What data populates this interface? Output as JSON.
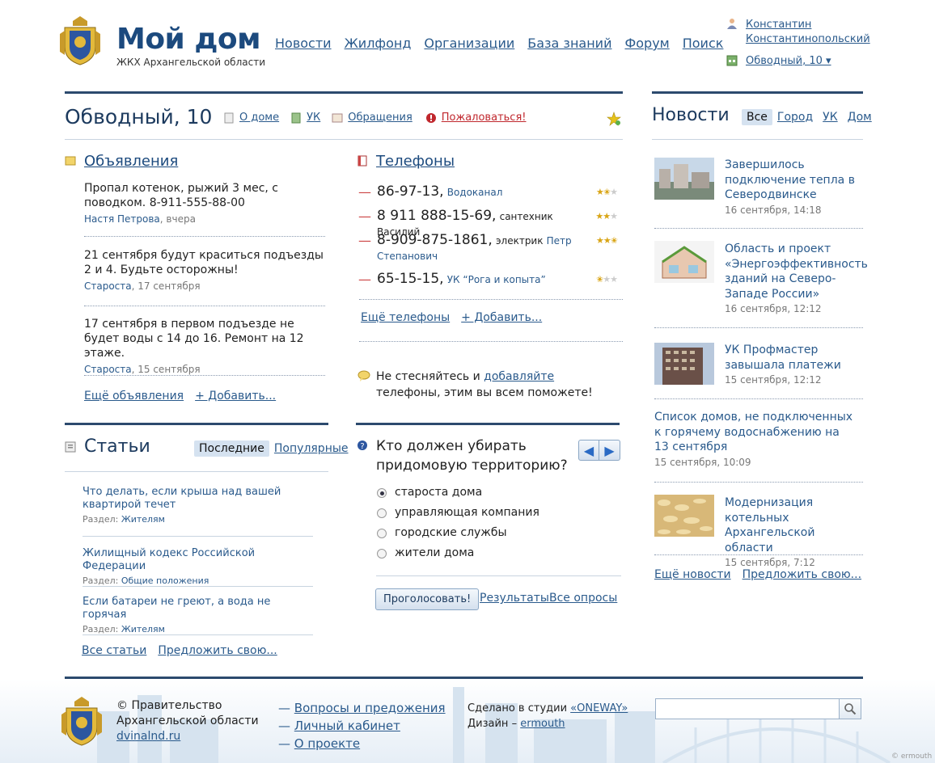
{
  "header": {
    "logo_title": "Мой дом",
    "logo_subtitle": "ЖКХ Архангельской области",
    "nav": [
      "Новости",
      "Жилфонд",
      "Организации",
      "База знаний",
      "Форум",
      "Поиск"
    ],
    "user_first": "Константин",
    "user_last": "Константинопольский",
    "address": "Обводный, 10 ▾"
  },
  "house": {
    "title": "Обводный, 10",
    "tabs": [
      "О доме",
      "УК",
      "Обращения"
    ],
    "complain": "Пожаловаться!"
  },
  "ads": {
    "title": "Объявления",
    "items": [
      {
        "text": "Пропал котенок, рыжий 3 мес, с поводком. 8-911-555-88-00",
        "author": "Настя Петрова",
        "date": ", вчера"
      },
      {
        "text": "21 сентября будут краситься подъезды 2 и 4. Будьте осторожны!",
        "author": "Староста",
        "date": ", 17 сентября"
      },
      {
        "text": "17 сентября в первом подъезде не будет воды с 14 до 16. Ремонт на 12 этаже.",
        "author": "Староста",
        "date": ", 15 сентября"
      }
    ],
    "more": "Ещё объявления",
    "add": "+ Добавить..."
  },
  "phones": {
    "title": "Телефоны",
    "items": [
      {
        "number": "86-97-13,",
        "desc": "",
        "link": "Водоканал",
        "rating": 1.5
      },
      {
        "number": "8 911 888-15-69,",
        "desc": "сантехник Василий",
        "link": "",
        "rating": 2
      },
      {
        "number": "8-909-875-1861,",
        "desc": "электрик",
        "link": "Петр Степанович",
        "rating": 2.5
      },
      {
        "number": "65-15-15,",
        "desc": "",
        "link": "УК “Рога и копыта”",
        "rating": 0.5
      }
    ],
    "more": "Ещё телефоны",
    "add": "+ Добавить...",
    "hint_pre": "Не стесняйтесь и",
    "hint_link": "добавляйте",
    "hint_post": "телефоны, этим вы всем поможете!"
  },
  "articles": {
    "title": "Статьи",
    "tab_active": "Последние",
    "tab_other": "Популярные",
    "items": [
      {
        "title": "Что делать, если крыша над вашей квартирой течет",
        "section_label": "Раздел:",
        "section": "Жителям"
      },
      {
        "title": "Жилищный кодекс Российской Федерации",
        "section_label": "Раздел:",
        "section": "Общие положения"
      },
      {
        "title": "Если батареи не греют, а вода не горячая",
        "section_label": "Раздел:",
        "section": "Жителям"
      }
    ],
    "all": "Все статьи",
    "suggest": "Предложить свою..."
  },
  "poll": {
    "question": "Кто должен убирать придомовую территорию?",
    "options": [
      "староста дома",
      "управляющая компания",
      "городские службы",
      "жители дома"
    ],
    "selected": 0,
    "vote": "Проголосовать!",
    "results": "Результаты",
    "all": "Все опросы"
  },
  "news": {
    "title": "Новости",
    "tabs": [
      "Все",
      "Город",
      "УК",
      "Дом"
    ],
    "items": [
      {
        "title": "Завершилось подключение тепла в Северодвинске",
        "date": "16 сентября, 14:18"
      },
      {
        "title": "Область и проект «Энергоэффективность зданий на Северо-Западе России»",
        "date": "16 сентября, 12:12"
      },
      {
        "title": "УК Профмастер завышала платежи",
        "date": "15 сентября, 12:12"
      },
      {
        "title": "Список домов, не подключенных к горячему водоснабжению на 13 сентября",
        "date": "15 сентября, 10:09"
      },
      {
        "title": "Модернизация котельных Архангельской области",
        "date": "15 сентября, 7:12"
      }
    ],
    "more": "Ещё новости",
    "suggest": "Предложить свою..."
  },
  "footer": {
    "copy1": "© Правительство",
    "copy2": "Архангельской области",
    "site": "dvinalnd.ru",
    "links": [
      "Вопросы и предожения",
      "Личный кабинет",
      "О проекте"
    ],
    "made_pre": "Сделано в студии",
    "made_link": "«ONEWAY»",
    "design_pre": "Дизайн –",
    "design_link": "ermouth",
    "credit": "© ermouth"
  },
  "colors": {
    "accent": "#1c4a7e",
    "link": "#2a5a8c",
    "rule": "#2c4a6e",
    "danger": "#c0272d"
  }
}
